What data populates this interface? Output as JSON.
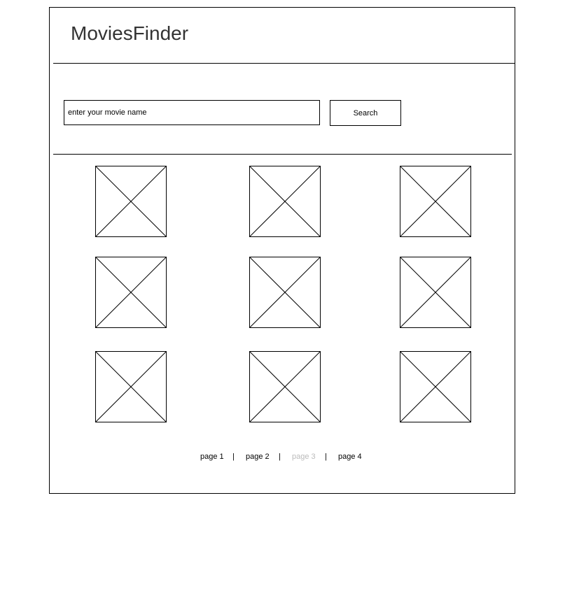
{
  "header": {
    "title": "MoviesFinder"
  },
  "search": {
    "placeholder": "enter your movie name",
    "value": "",
    "button_label": "Search"
  },
  "results": {
    "items": [
      {
        "icon": "image-placeholder-icon"
      },
      {
        "icon": "image-placeholder-icon"
      },
      {
        "icon": "image-placeholder-icon"
      },
      {
        "icon": "image-placeholder-icon"
      },
      {
        "icon": "image-placeholder-icon"
      },
      {
        "icon": "image-placeholder-icon"
      },
      {
        "icon": "image-placeholder-icon"
      },
      {
        "icon": "image-placeholder-icon"
      },
      {
        "icon": "image-placeholder-icon"
      }
    ]
  },
  "pagination": {
    "separator": "|",
    "pages": [
      {
        "label": "page 1",
        "disabled": false
      },
      {
        "label": "page 2",
        "disabled": false
      },
      {
        "label": "page 3",
        "disabled": true
      },
      {
        "label": "page 4",
        "disabled": false
      }
    ]
  },
  "colors": {
    "border": "#000000",
    "title": "#333333",
    "disabled_page": "#bbbbbb"
  }
}
